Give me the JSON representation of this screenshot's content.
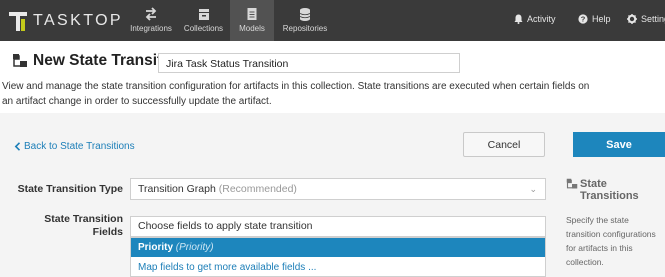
{
  "brand": {
    "logo_text": "TASKTOP"
  },
  "nav": {
    "tabs": [
      {
        "label": "Integrations",
        "icon": "arrows-icon"
      },
      {
        "label": "Collections",
        "icon": "collection-icon"
      },
      {
        "label": "Models",
        "icon": "document-icon"
      },
      {
        "label": "Repositories",
        "icon": "database-icon"
      }
    ],
    "activity_label": "Activity",
    "help_label": "Help",
    "settings_label": "Settings"
  },
  "header": {
    "title": "New State Transition",
    "name_value": "Jira Task Status Transition",
    "description": "View and manage the state transition configuration for artifacts in this collection. State transitions are executed when certain fields on an artifact change in order to successfully update the artifact."
  },
  "actions": {
    "back_label": "Back to State Transitions",
    "cancel_label": "Cancel",
    "save_label": "Save"
  },
  "form": {
    "type_label": "State Transition Type",
    "type_value": "Transition Graph",
    "type_hint": "(Recommended)",
    "fields_label_line1": "State Transition",
    "fields_label_line2": "Fields",
    "fields_placeholder": "Choose fields to apply state transition",
    "options": [
      {
        "label": "Priority",
        "sub": "(Priority)"
      }
    ],
    "map_fields_label": "Map fields to get more available fields ..."
  },
  "help": {
    "title_line1": "State",
    "title_line2": "Transitions",
    "text": "Specify the state transition configurations for artifacts in this collection."
  },
  "colors": {
    "accent": "#1d86bd",
    "topbar": "#3a3a3a",
    "logo_accent": "#c2c91a"
  }
}
